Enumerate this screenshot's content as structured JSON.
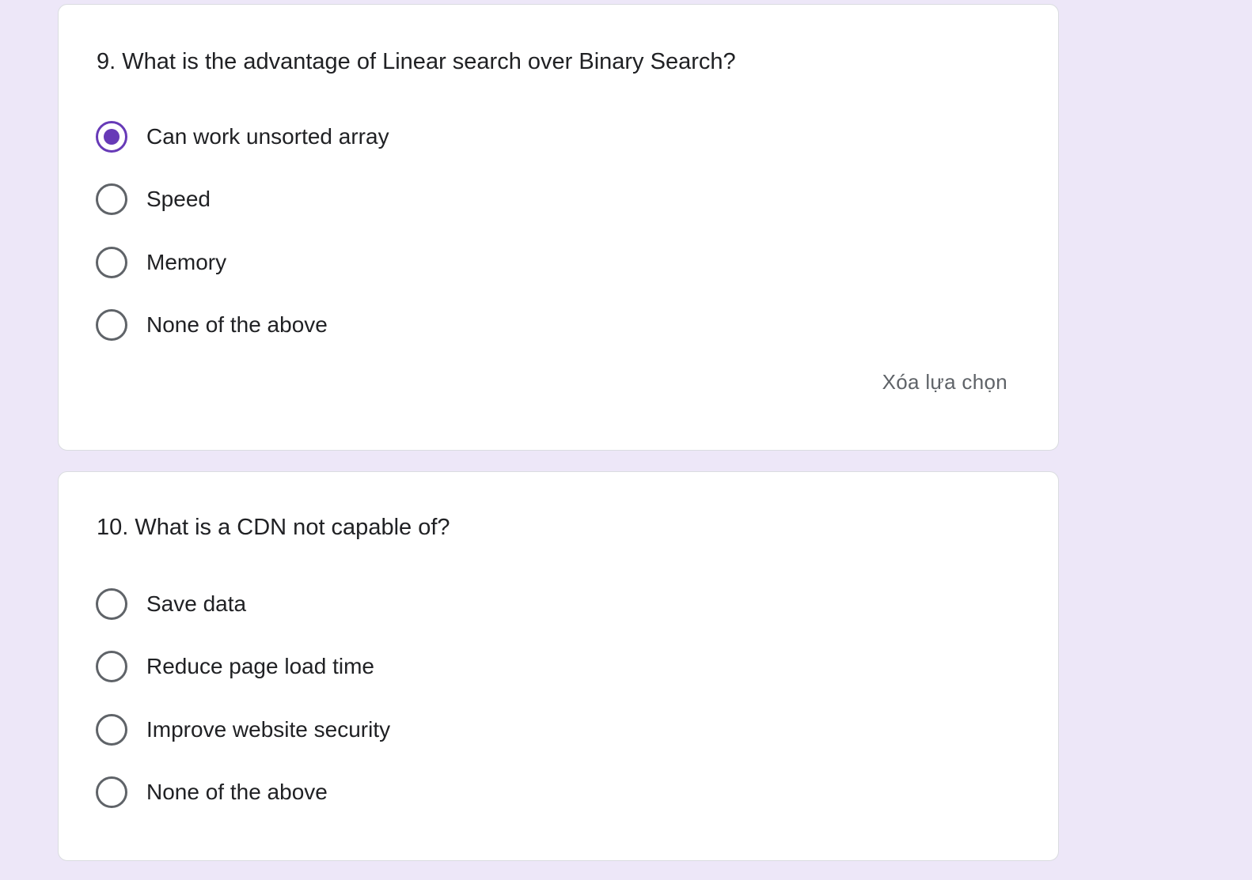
{
  "colors": {
    "page_background": "#ede7f8",
    "card_background": "#ffffff",
    "accent": "#673ab7",
    "text_primary": "#202124",
    "text_secondary": "#5f6368"
  },
  "questions": [
    {
      "title": "9. What is the advantage of Linear search over Binary Search?",
      "selected_index": 0,
      "options": [
        {
          "label": "Can work unsorted array",
          "selected": true
        },
        {
          "label": "Speed",
          "selected": false
        },
        {
          "label": "Memory",
          "selected": false
        },
        {
          "label": "None of the above",
          "selected": false
        }
      ],
      "clear_label": "Xóa lựa chọn"
    },
    {
      "title": "10. What is a CDN not capable of?",
      "selected_index": null,
      "options": [
        {
          "label": "Save data",
          "selected": false
        },
        {
          "label": "Reduce page load time",
          "selected": false
        },
        {
          "label": "Improve website security",
          "selected": false
        },
        {
          "label": "None of the above",
          "selected": false
        }
      ]
    }
  ]
}
